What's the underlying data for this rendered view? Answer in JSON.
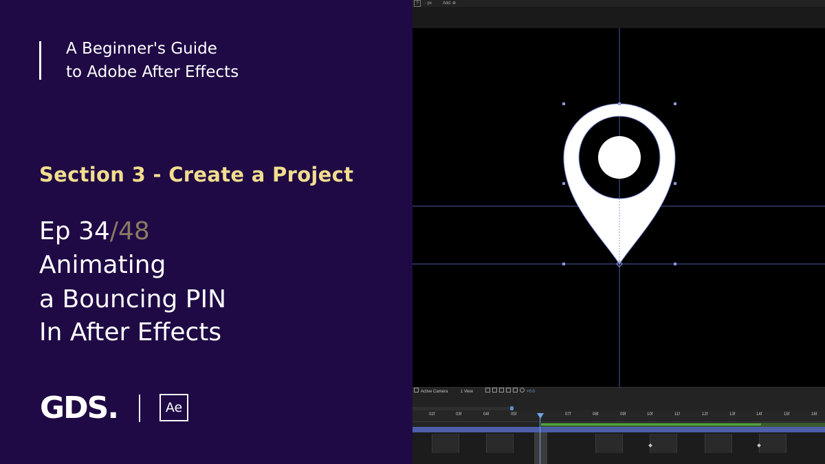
{
  "series": {
    "line1": "A Beginner's Guide",
    "line2": "to Adobe After Effects"
  },
  "section": "Section 3 - Create a Project",
  "episode": {
    "prefix": "Ep 34",
    "total": "/48"
  },
  "title": {
    "line1": "Animating",
    "line2": "a Bouncing PIN",
    "line3": "In After Effects"
  },
  "logos": {
    "gds": "GDS.",
    "ae": "Ae"
  },
  "ae_ui": {
    "topbar": {
      "help": "?",
      "px": "- px",
      "add": "Add: ⊕"
    },
    "viewer_bar": {
      "camera": "Active Camera",
      "view": "1 View",
      "exposure": "+0.0"
    },
    "timeline_ticks": [
      "02f",
      "03f",
      "04f",
      "05f",
      "07f",
      "08f",
      "09f",
      "10f",
      "11f",
      "12f",
      "13f",
      "14f",
      "15f",
      "16f"
    ]
  },
  "colors": {
    "left_bg": "#1f0a45",
    "section_yellow": "#f3dd8f",
    "ep_total_gray": "#8a7a63",
    "guide_blue": "#4a5aa8",
    "playhead_blue": "#6ea7e8"
  },
  "icons": [
    "map-pin-shape",
    "ae-logo",
    "gds-logo",
    "playhead-icon"
  ]
}
